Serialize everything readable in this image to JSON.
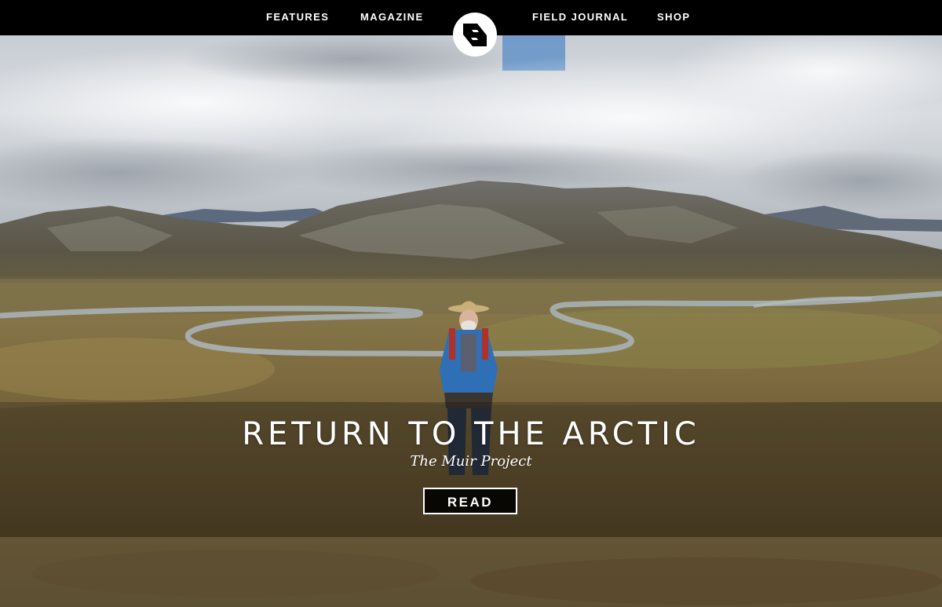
{
  "nav": {
    "items": [
      {
        "label": "FEATURES"
      },
      {
        "label": "MAGAZINE"
      },
      {
        "label": "FIELD JOURNAL"
      },
      {
        "label": "SHOP"
      }
    ]
  },
  "hero": {
    "title": "RETURN TO THE ARCTIC",
    "subtitle": "The Muir Project",
    "cta_label": "READ"
  },
  "colors": {
    "nav_background": "#000000",
    "nav_text": "#ffffff",
    "cta_border": "#ffffff"
  },
  "icons": {
    "logo": "site-logo-icon"
  }
}
